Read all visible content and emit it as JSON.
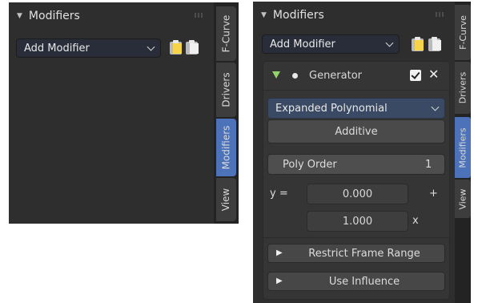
{
  "panel_left": {
    "header": {
      "title": "Modifiers"
    },
    "add_modifier": {
      "label": "Add Modifier"
    },
    "tabs": [
      {
        "label": "F-Curve"
      },
      {
        "label": "Drivers"
      },
      {
        "label": "Modifiers"
      },
      {
        "label": "View"
      }
    ]
  },
  "panel_right": {
    "header": {
      "title": "Modifiers"
    },
    "add_modifier": {
      "label": "Add Modifier"
    },
    "tabs": [
      {
        "label": "F-Curve"
      },
      {
        "label": "Drivers"
      },
      {
        "label": "Modifiers"
      },
      {
        "label": "View"
      }
    ],
    "generator": {
      "name": "Generator",
      "mode": "Expanded Polynomial",
      "additive": "Additive",
      "poly_order_label": "Poly Order",
      "poly_order_value": "1",
      "y_label": "y =",
      "coef0": "0.000",
      "plus": "+",
      "coef1": "1.000",
      "x": "x",
      "restrict_frame_range": "Restrict Frame Range",
      "use_influence": "Use Influence"
    }
  },
  "colors": {
    "active_tab": "#4c73b9",
    "generator_triangle": "#92d46a",
    "clipboard_paper": "#f7d34a"
  }
}
